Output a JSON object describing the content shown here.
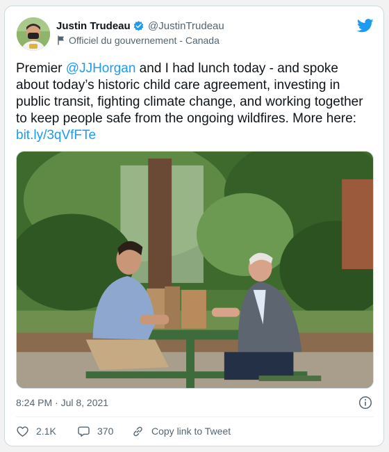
{
  "tweet": {
    "author_name": "Justin Trudeau",
    "handle": "@JustinTrudeau",
    "affiliation_label": "Officiel du gouvernement - Canada",
    "text_parts": [
      "Premier ",
      "@JJHorgan",
      " and I had lunch today - and spoke about today’s historic child care agreement, investing in public transit, fighting climate change, and working together to keep people safe from the ongoing wildfires. More here: ",
      "bit.ly/3qVfFTe"
    ],
    "timestamp": "8:24 PM · Jul 8, 2021"
  },
  "actions": {
    "likes": "2.1K",
    "replies": "370",
    "copy_link_label": "Copy link to Tweet"
  },
  "colors": {
    "link": "#1d9bf0",
    "text": "#0f1419",
    "secondary": "#536471",
    "verified": "#1d9bf0"
  },
  "icons": {
    "verified": "verified-badge-icon",
    "government": "government-flag-icon",
    "brand": "twitter-bird-icon",
    "info": "info-icon",
    "like": "heart-icon",
    "reply": "reply-bubble-icon",
    "copy": "link-icon"
  }
}
